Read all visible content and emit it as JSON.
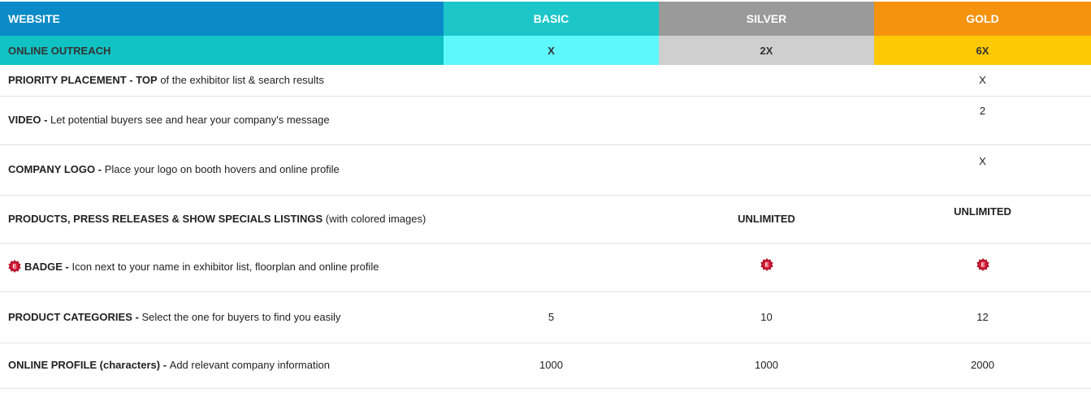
{
  "header": {
    "col_website": "WEBSITE",
    "col_basic": "BASIC",
    "col_silver": "SILVER",
    "col_gold": "GOLD"
  },
  "outreach": {
    "label": "ONLINE OUTREACH",
    "basic": "X",
    "silver": "2X",
    "gold": "6X"
  },
  "rows": [
    {
      "bold": "PRIORITY PLACEMENT - TOP",
      "rest": " of the exhibitor list & search results",
      "basic": "",
      "silver": "",
      "gold": "X"
    },
    {
      "bold": "VIDEO - ",
      "rest": "Let potential buyers see and hear your company's message",
      "basic": "",
      "silver": "",
      "gold": "2"
    },
    {
      "bold": "COMPANY LOGO - ",
      "rest": "Place your logo on booth hovers and online profile",
      "basic": "",
      "silver": "",
      "gold": "X"
    },
    {
      "bold": "PRODUCTS, PRESS RELEASES & SHOW SPECIALS LISTINGS",
      "rest": " (with colored images)",
      "basic": "",
      "silver": "UNLIMITED",
      "gold": "UNLIMITED"
    },
    {
      "bold": "BADGE - ",
      "rest": " Icon next to your name in exhibitor list, floorplan and online profile",
      "icon": "exhibitor-badge-icon",
      "basic": "",
      "silver": "",
      "gold": ""
    },
    {
      "bold": "PRODUCT CATEGORIES - ",
      "rest": "Select the one for buyers to find you easily",
      "basic": "5",
      "silver": "10",
      "gold": "12"
    },
    {
      "bold": "ONLINE PROFILE (characters) - ",
      "rest": "Add relevant company information",
      "basic": "1000",
      "silver": "1000",
      "gold": "2000"
    }
  ],
  "colors": {
    "website": "#0a8bc7",
    "basic": "#1cc6c9",
    "silver": "#9a9a9a",
    "gold": "#f5930f",
    "badge": "#b3132a"
  }
}
